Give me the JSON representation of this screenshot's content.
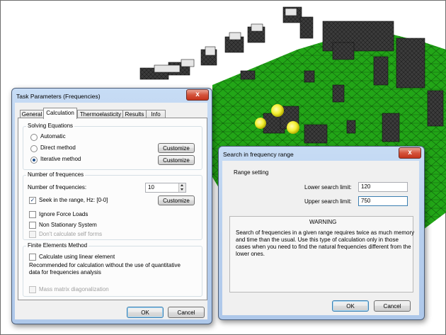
{
  "task_dialog": {
    "title": "Task Parameters (Frequencies)",
    "close_glyph": "x",
    "tabs": [
      {
        "label": "General"
      },
      {
        "label": "Calculation"
      },
      {
        "label": "Thermoelasticity"
      },
      {
        "label": "Results"
      },
      {
        "label": "Info"
      }
    ],
    "active_tab": "Calculation",
    "solving": {
      "title": "Solving Equations",
      "options": [
        {
          "label": "Automatic",
          "selected": false
        },
        {
          "label": "Direct method",
          "selected": false
        },
        {
          "label": "Iterative method",
          "selected": true
        }
      ],
      "customize_label": "Customize"
    },
    "frequences": {
      "title": "Number of frequences",
      "count_label": "Number of frequencies:",
      "count_value": "10",
      "seek_label": "Seek in the range, Hz: [0-0]",
      "seek_checked": true,
      "customize_label": "Customize",
      "ignore_force_label": "Ignore Force Loads",
      "non_stationary_label": "Non Stationary System",
      "dont_calc_label": "Don't calculate self forms"
    },
    "fem": {
      "title": "Finite Elements Method",
      "linear_label": "Calculate using linear element",
      "recommend_line1": "Recommended for calculation without the use of quantitative",
      "recommend_line2": "data for frequencies analysis",
      "mass_label": "Mass matrix diagonalization"
    },
    "ok_label": "OK",
    "cancel_label": "Cancel"
  },
  "search_dialog": {
    "title": "Search in frequency range",
    "close_glyph": "x",
    "range_title": "Range setting",
    "lower_label": "Lower search limit:",
    "lower_value": "120",
    "upper_label": "Upper search limit:",
    "upper_value": "750",
    "warning_title": "WARNING",
    "warning_line1": "Search of frequencies in a given range requires twice as much memory",
    "warning_line2": "and time than the usual. Use this type of calculation only in those",
    "warning_line3": "cases when you need to find the natural frequencies different from the",
    "warning_line4": "lower ones.",
    "ok_label": "OK",
    "cancel_label": "Cancel"
  },
  "colors": {
    "mesh_green": "#1fa516",
    "component_dark": "#2e2e2e",
    "sphere_yellow": "#f4f43a"
  }
}
